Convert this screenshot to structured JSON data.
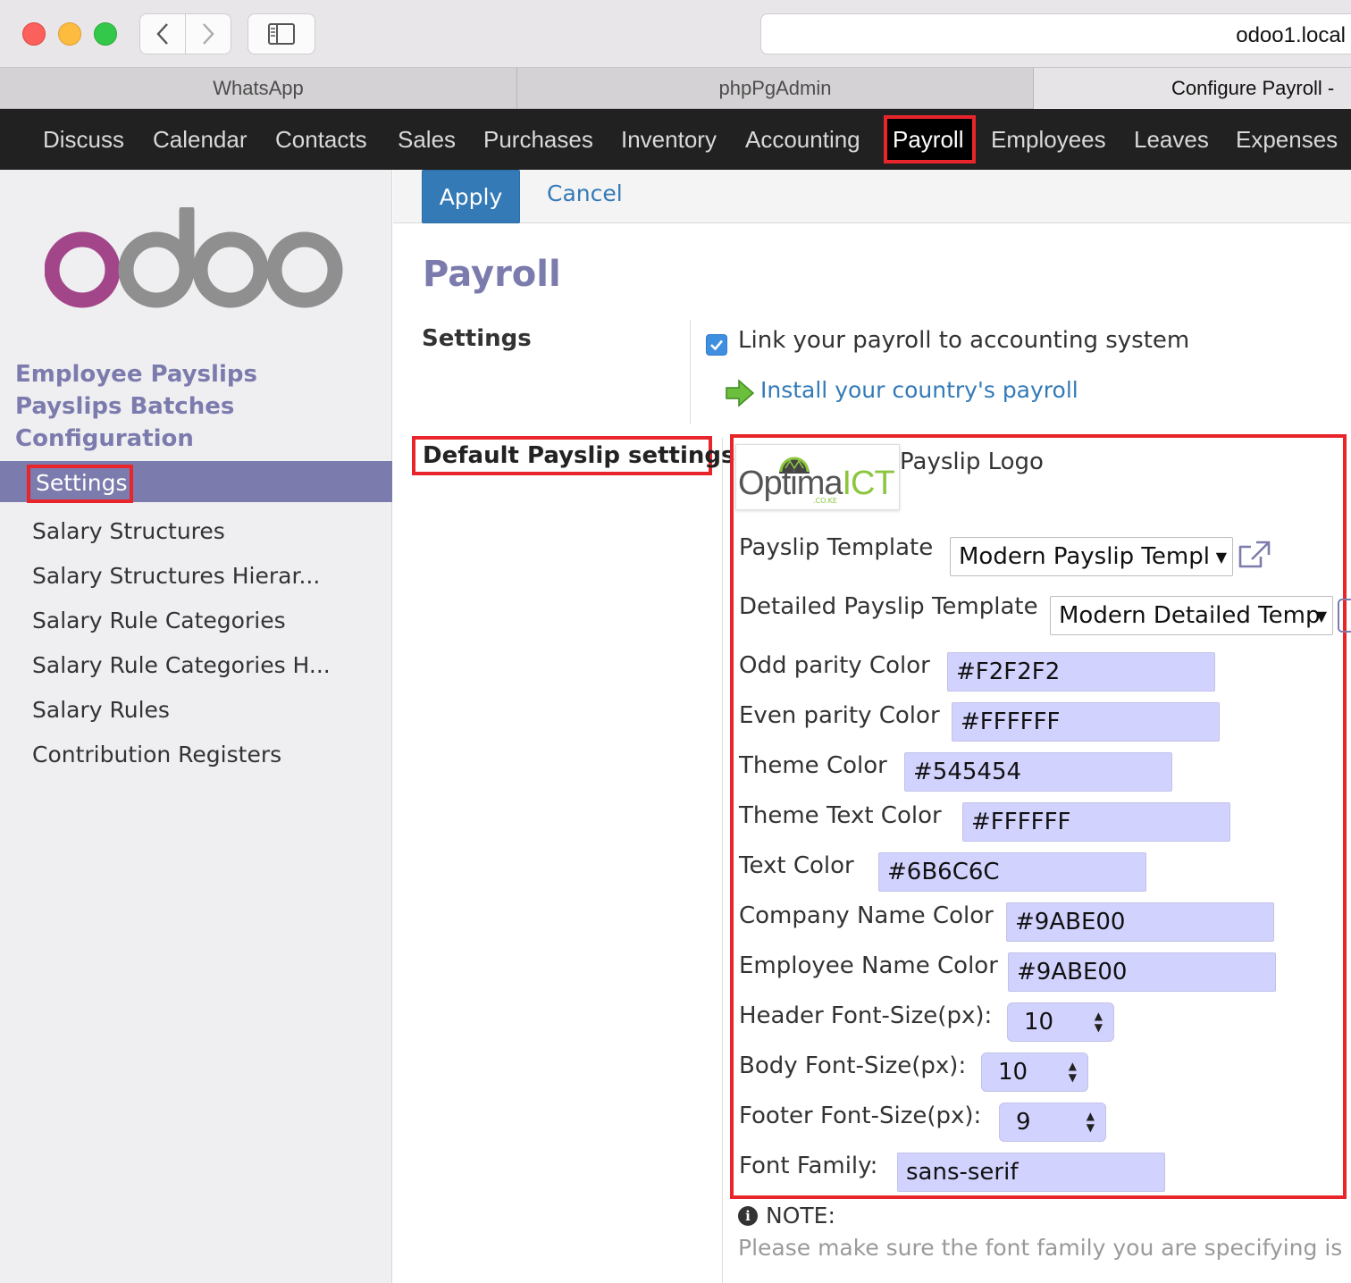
{
  "browser": {
    "url": "odoo1.local",
    "tabs": [
      {
        "label": "WhatsApp"
      },
      {
        "label": "phpPgAdmin"
      },
      {
        "label": "Configure Payroll -"
      }
    ]
  },
  "topmenu": {
    "items": [
      {
        "label": "Discuss"
      },
      {
        "label": "Calendar"
      },
      {
        "label": "Contacts"
      },
      {
        "label": "Sales"
      },
      {
        "label": "Purchases"
      },
      {
        "label": "Inventory"
      },
      {
        "label": "Accounting"
      },
      {
        "label": "Payroll"
      },
      {
        "label": "Employees"
      },
      {
        "label": "Leaves"
      },
      {
        "label": "Expenses"
      }
    ]
  },
  "sidebar": {
    "sections": [
      {
        "label": "Employee Payslips"
      },
      {
        "label": "Payslips Batches"
      },
      {
        "label": "Configuration"
      }
    ],
    "active_item": "Settings",
    "items": [
      {
        "label": "Salary Structures"
      },
      {
        "label": "Salary Structures Hierar..."
      },
      {
        "label": "Salary Rule Categories"
      },
      {
        "label": "Salary Rule Categories H..."
      },
      {
        "label": "Salary Rules"
      },
      {
        "label": "Contribution Registers"
      }
    ]
  },
  "control": {
    "apply_label": "Apply",
    "cancel_label": "Cancel"
  },
  "form": {
    "title": "Payroll",
    "settings_title": "Settings",
    "link_accounting_label": "Link your payroll to accounting system",
    "link_accounting_checked": true,
    "install_link": "Install your country's payroll",
    "default_section": "Default Payslip settings",
    "logo": {
      "label": "Payslip Logo",
      "brand_main": "Optima",
      "brand_accent": "ICT",
      "brand_sub": ".CO.KE"
    },
    "payslip_template": {
      "label": "Payslip Template",
      "value": "Modern Payslip Templ"
    },
    "detailed_template": {
      "label": "Detailed Payslip Template",
      "value": "Modern Detailed Temp"
    },
    "odd_color": {
      "label": "Odd parity Color",
      "value": "#F2F2F2"
    },
    "even_color": {
      "label": "Even parity Color",
      "value": "#FFFFFF"
    },
    "theme_color": {
      "label": "Theme Color",
      "value": "#545454"
    },
    "theme_text_color": {
      "label": "Theme Text Color",
      "value": "#FFFFFF"
    },
    "text_color": {
      "label": "Text Color",
      "value": "#6B6C6C"
    },
    "company_name_color": {
      "label": "Company Name Color",
      "value": "#9ABE00"
    },
    "employee_name_color": {
      "label": "Employee Name Color",
      "value": "#9ABE00"
    },
    "header_font_size": {
      "label": "Header Font-Size(px):",
      "value": "10"
    },
    "body_font_size": {
      "label": "Body Font-Size(px):",
      "value": "10"
    },
    "footer_font_size": {
      "label": "Footer Font-Size(px):",
      "value": "9"
    },
    "font_family": {
      "label": "Font Family:",
      "value": "sans-serif"
    },
    "note_label": "NOTE:",
    "note_text": "Please make sure the font family you are specifying is"
  },
  "colors": {
    "brand_purple": "#7c7bad",
    "primary_blue": "#337ab7",
    "highlight_red": "#e8252a",
    "menu_bg": "#212121",
    "input_bg": "#d2d2ff"
  },
  "icons": [
    "back-chevron-icon",
    "forward-chevron-icon",
    "sidebar-icon",
    "checkmark-icon",
    "green-arrow-icon",
    "external-link-icon",
    "info-icon"
  ]
}
